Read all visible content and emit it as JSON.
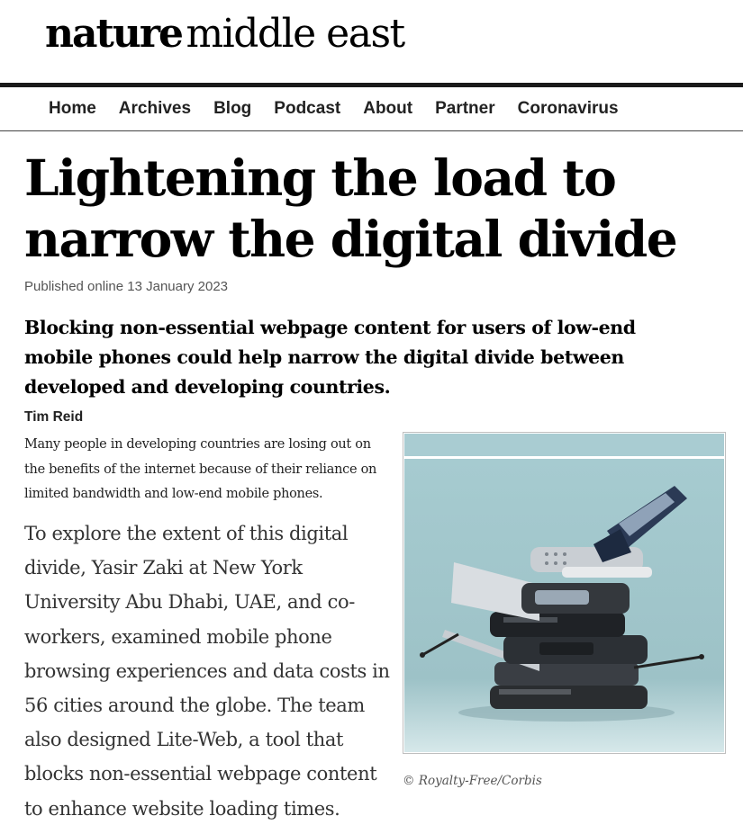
{
  "masthead": {
    "brand_bold": "nature",
    "brand_rest": "middle east"
  },
  "nav": {
    "items": [
      "Home",
      "Archives",
      "Blog",
      "Podcast",
      "About",
      "Partner",
      "Coronavirus"
    ]
  },
  "article": {
    "headline": "Lightening the load to narrow the digital divide",
    "published": "Published online 13 January 2023",
    "standfirst": "Blocking non-essential webpage content for users of low-end mobile phones could help narrow the digital divide between developed and developing countries.",
    "author": "Tim Reid",
    "summary": "Many people in developing countries are losing out on the benefits of the internet because of their reliance on limited bandwidth and low-end mobile phones.",
    "body": "To explore the extent of this digital divide, Yasir Zaki at New York University Abu Dhabi, UAE,  and co-workers, examined mobile phone browsing experiences and data costs in 56 cities around the globe. The team also designed Lite-Web, a tool that blocks non-essential webpage content to enhance website loading times."
  },
  "figure": {
    "caption": "© Royalty-Free/Corbis",
    "image_subject": "stack-of-old-mobile-phones"
  },
  "colors": {
    "background": "#ffffff",
    "photo_bg": "#9fc4c9",
    "nav_rule": "#1a1a1a"
  }
}
